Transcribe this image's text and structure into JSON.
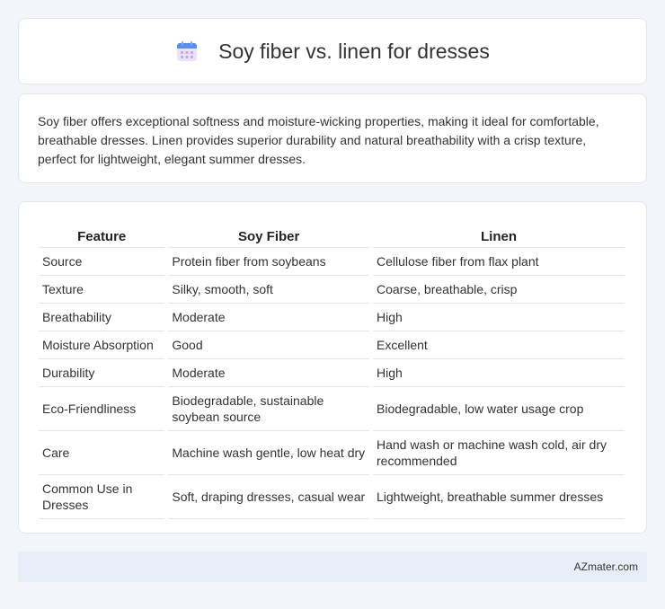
{
  "header": {
    "title": "Soy fiber vs. linen for dresses",
    "icon": "calendar-icon"
  },
  "intro": {
    "text": "Soy fiber offers exceptional softness and moisture-wicking properties, making it ideal for comfortable, breathable dresses. Linen provides superior durability and natural breathability with a crisp texture, perfect for lightweight, elegant summer dresses."
  },
  "table": {
    "headers": [
      "Feature",
      "Soy Fiber",
      "Linen"
    ],
    "rows": [
      [
        "Source",
        "Protein fiber from soybeans",
        "Cellulose fiber from flax plant"
      ],
      [
        "Texture",
        "Silky, smooth, soft",
        "Coarse, breathable, crisp"
      ],
      [
        "Breathability",
        "Moderate",
        "High"
      ],
      [
        "Moisture Absorption",
        "Good",
        "Excellent"
      ],
      [
        "Durability",
        "Moderate",
        "High"
      ],
      [
        "Eco-Friendliness",
        "Biodegradable, sustainable soybean source",
        "Biodegradable, low water usage crop"
      ],
      [
        "Care",
        "Machine wash gentle, low heat dry",
        "Hand wash or machine wash cold, air dry recommended"
      ],
      [
        "Common Use in Dresses",
        "Soft, draping dresses, casual wear",
        "Lightweight, breathable summer dresses"
      ]
    ]
  },
  "footer": {
    "text": "AZmater.com"
  },
  "colors": {
    "background": "#f2f5fa",
    "card": "#ffffff",
    "footer": "#e8eef7",
    "icon_accent": "#5b8def"
  }
}
